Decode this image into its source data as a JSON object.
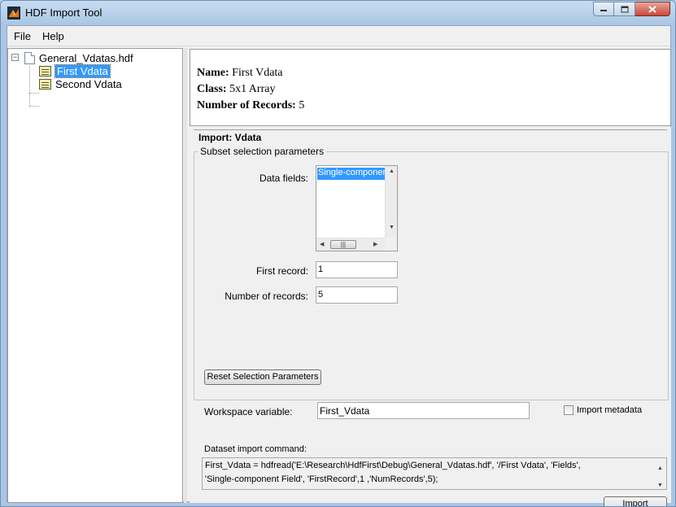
{
  "window": {
    "title": "HDF Import Tool",
    "controls": [
      "minimize",
      "maximize",
      "close"
    ]
  },
  "menu": {
    "items": [
      "File",
      "Help"
    ]
  },
  "tree": {
    "root": {
      "label": "General_Vdatas.hdf",
      "expanded": true,
      "icon": "file-icon"
    },
    "children": [
      {
        "label": "First Vdata",
        "selected": true,
        "icon": "vdata-table-icon"
      },
      {
        "label": "Second Vdata",
        "selected": false,
        "icon": "vdata-table-icon"
      }
    ]
  },
  "info": {
    "name_label": "Name:",
    "name_value": "First Vdata",
    "class_label": "Class:",
    "class_value": "5x1 Array",
    "records_label": "Number of Records:",
    "records_value": "5"
  },
  "import": {
    "title": "Import: Vdata",
    "group_title": "Subset selection parameters",
    "data_fields_label": "Data fields:",
    "data_fields_options": [
      "Single-component Field"
    ],
    "data_fields_visible": "Single-componen",
    "first_record_label": "First record:",
    "first_record_value": "1",
    "num_records_label": "Number of records:",
    "num_records_value": "5",
    "reset_button": "Reset Selection Parameters",
    "workspace_label": "Workspace variable:",
    "workspace_value": "First_Vdata",
    "metadata_label": "Import metadata",
    "metadata_checked": false,
    "command_label": "Dataset import command:",
    "command_line1": "First_Vdata = hdfread('E:\\Research\\HdfFirst\\Debug\\General_Vdatas.hdf', '/First Vdata', 'Fields',",
    "command_line2": "'Single-component Field', 'FirstRecord',1 ,'NumRecords',5);",
    "import_button": "Import"
  },
  "colors": {
    "selection": "#3399ff",
    "panel": "#f0f0f0",
    "titlebar": "#c7dcf1"
  }
}
